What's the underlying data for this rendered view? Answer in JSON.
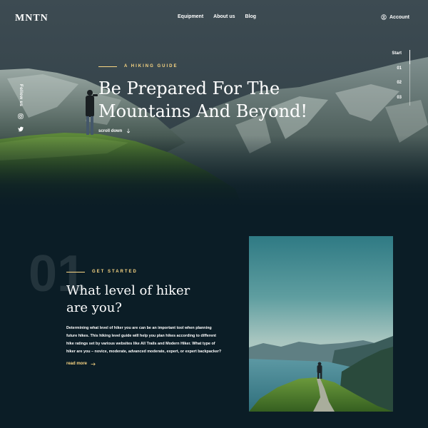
{
  "header": {
    "logo": "MNTN",
    "nav": [
      {
        "label": "Equipment"
      },
      {
        "label": "About us"
      },
      {
        "label": "Blog"
      }
    ],
    "account_label": "Account",
    "account_icon": "user-circle-icon"
  },
  "social": {
    "follow_label": "Follow us",
    "icons": [
      "instagram-icon",
      "twitter-icon"
    ]
  },
  "hero": {
    "eyebrow": "A HIKING GUIDE",
    "title_line1": "Be Prepared For The",
    "title_line2": "Mountains And Beyond!",
    "scroll_label": "scroll down",
    "scroll_icon": "arrow-down-icon"
  },
  "stepper": {
    "start_label": "Start",
    "steps": [
      "01",
      "02",
      "03"
    ]
  },
  "section": {
    "number": "01",
    "eyebrow": "GET STARTED",
    "title_line1": "What level of hiker",
    "title_line2": "are you?",
    "body": "Determining what level of hiker you are can be an important tool when planning future hikes. This hiking level guide will help you plan hikes according to different hike ratings set by various websites like All Trails and Modern Hiker. What type of hiker are you – novice, moderate, advanced moderate, expert, or expert backpacker?",
    "read_more": "read more",
    "read_more_icon": "arrow-right-icon"
  },
  "colors": {
    "background": "#0b1d26",
    "accent": "#fbd784",
    "text": "#ffffff"
  }
}
